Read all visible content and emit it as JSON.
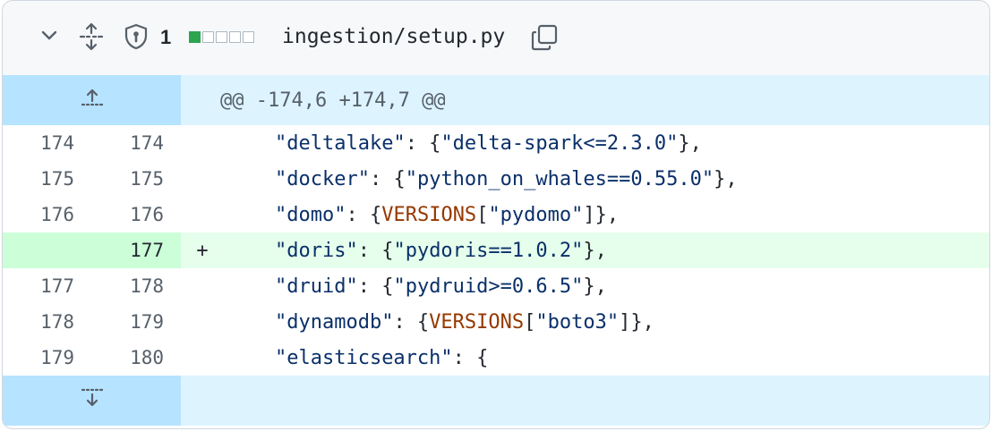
{
  "header": {
    "change_count": "1",
    "diffstat": [
      "add",
      "neutral",
      "neutral",
      "neutral",
      "neutral"
    ],
    "filename": "ingestion/setup.py"
  },
  "hunk": {
    "header_text": "@@ -174,6 +174,7 @@"
  },
  "lines": [
    {
      "old": "174",
      "new": "174",
      "marker": "",
      "type": "context",
      "tokens": [
        {
          "t": "    ",
          "c": "punc"
        },
        {
          "t": "\"deltalake\"",
          "c": "str"
        },
        {
          "t": ": {",
          "c": "punc"
        },
        {
          "t": "\"delta-spark<=2.3.0\"",
          "c": "str"
        },
        {
          "t": "},",
          "c": "punc"
        }
      ]
    },
    {
      "old": "175",
      "new": "175",
      "marker": "",
      "type": "context",
      "tokens": [
        {
          "t": "    ",
          "c": "punc"
        },
        {
          "t": "\"docker\"",
          "c": "str"
        },
        {
          "t": ": {",
          "c": "punc"
        },
        {
          "t": "\"python_on_whales==0.55.0\"",
          "c": "str"
        },
        {
          "t": "},",
          "c": "punc"
        }
      ]
    },
    {
      "old": "176",
      "new": "176",
      "marker": "",
      "type": "context",
      "tokens": [
        {
          "t": "    ",
          "c": "punc"
        },
        {
          "t": "\"domo\"",
          "c": "str"
        },
        {
          "t": ": {",
          "c": "punc"
        },
        {
          "t": "VERSIONS",
          "c": "const"
        },
        {
          "t": "[",
          "c": "punc"
        },
        {
          "t": "\"pydomo\"",
          "c": "str"
        },
        {
          "t": "]},",
          "c": "punc"
        }
      ]
    },
    {
      "old": "",
      "new": "177",
      "marker": "+",
      "type": "added",
      "tokens": [
        {
          "t": "    ",
          "c": "punc"
        },
        {
          "t": "\"doris\"",
          "c": "str"
        },
        {
          "t": ": {",
          "c": "punc"
        },
        {
          "t": "\"pydoris==1.0.2\"",
          "c": "str"
        },
        {
          "t": "},",
          "c": "punc"
        }
      ]
    },
    {
      "old": "177",
      "new": "178",
      "marker": "",
      "type": "context",
      "tokens": [
        {
          "t": "    ",
          "c": "punc"
        },
        {
          "t": "\"druid\"",
          "c": "str"
        },
        {
          "t": ": {",
          "c": "punc"
        },
        {
          "t": "\"pydruid>=0.6.5\"",
          "c": "str"
        },
        {
          "t": "},",
          "c": "punc"
        }
      ]
    },
    {
      "old": "178",
      "new": "179",
      "marker": "",
      "type": "context",
      "tokens": [
        {
          "t": "    ",
          "c": "punc"
        },
        {
          "t": "\"dynamodb\"",
          "c": "str"
        },
        {
          "t": ": {",
          "c": "punc"
        },
        {
          "t": "VERSIONS",
          "c": "const"
        },
        {
          "t": "[",
          "c": "punc"
        },
        {
          "t": "\"boto3\"",
          "c": "str"
        },
        {
          "t": "]},",
          "c": "punc"
        }
      ]
    },
    {
      "old": "179",
      "new": "180",
      "marker": "",
      "type": "context",
      "tokens": [
        {
          "t": "    ",
          "c": "punc"
        },
        {
          "t": "\"elasticsearch\"",
          "c": "str"
        },
        {
          "t": ": {",
          "c": "punc"
        }
      ]
    }
  ],
  "icons": {
    "collapse": "chevron-down-icon",
    "expand_all": "unfold-icon",
    "security": "shield-icon",
    "copy": "copy-icon",
    "expand_up": "expand-up-icon",
    "expand_down": "expand-down-icon"
  },
  "colors": {
    "added_bg": "#e6ffec",
    "added_gutter": "#ccffd8",
    "hunk_bg": "#ddf4ff",
    "hunk_gutter": "#b6e3ff",
    "string": "#0a3069",
    "constant": "#953800",
    "diffstat_add": "#2da44e"
  }
}
